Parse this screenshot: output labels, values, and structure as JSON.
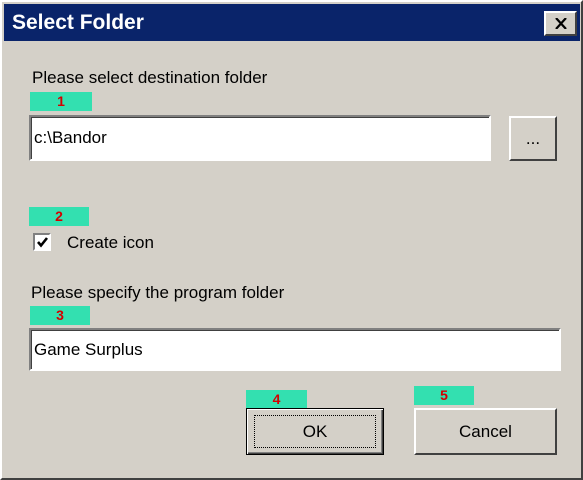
{
  "dialog": {
    "title": "Select Folder",
    "close_symbol": "×"
  },
  "destination": {
    "label": "Please select destination folder",
    "marker": "1",
    "value": "c:\\Bandor",
    "browse_label": "..."
  },
  "create_icon": {
    "marker": "2",
    "label": "Create icon",
    "checked": true
  },
  "program_folder": {
    "label": "Please specify the program folder",
    "marker": "3",
    "value": "Game Surplus"
  },
  "buttons": {
    "ok_marker": "4",
    "ok_label": "OK",
    "cancel_marker": "5",
    "cancel_label": "Cancel"
  },
  "colors": {
    "title_bar": "#0a246a",
    "face": "#d4d0c8",
    "marker_bg": "#33e0b0",
    "marker_text": "#d40000"
  },
  "icons": [
    "close-icon",
    "checkmark-icon"
  ]
}
